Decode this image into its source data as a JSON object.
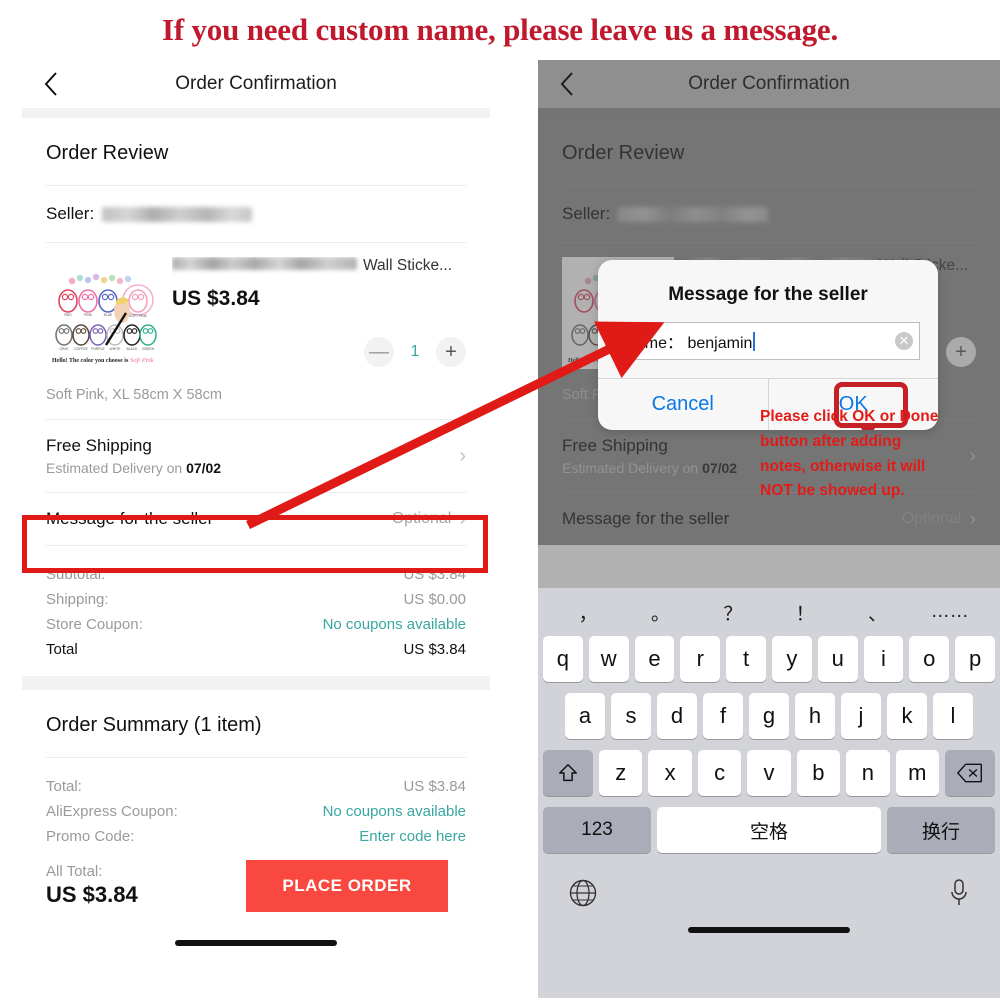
{
  "banner": {
    "text": "If you need custom name, please leave us a message."
  },
  "nav": {
    "title": "Order Confirmation",
    "back_icon": "chevron-left-icon"
  },
  "order_review": {
    "section_title": "Order Review",
    "seller_label": "Seller:",
    "product": {
      "title_suffix": "Wall Sticke...",
      "price": "US $3.84",
      "quantity": "1",
      "minus_label": "—",
      "plus_label": "+",
      "variant": "Soft Pink, XL 58cm X 58cm"
    },
    "shipping": {
      "title": "Free Shipping",
      "sub_prefix": "Estimated Delivery on ",
      "sub_date": "07/02"
    },
    "message_row": {
      "label": "Message for the seller",
      "value": "Optional"
    },
    "prices": [
      {
        "key": "Subtotal:",
        "value": "US $3.84",
        "link": false
      },
      {
        "key": "Shipping:",
        "value": "US $0.00",
        "link": false
      },
      {
        "key": "Store Coupon:",
        "value": "No coupons available",
        "link": true
      },
      {
        "key": "Total",
        "value": "US $3.84",
        "link": false,
        "emphasis": true
      }
    ]
  },
  "order_summary": {
    "section_title": "Order Summary (1 item)",
    "lines": [
      {
        "key": "Total:",
        "value": "US $3.84",
        "link": false
      },
      {
        "key": "AliExpress Coupon:",
        "value": "No coupons available",
        "link": true
      },
      {
        "key": "Promo Code:",
        "value": "Enter code here",
        "link": true
      }
    ],
    "all_total_label": "All Total:",
    "all_total_value": "US $3.84",
    "place_order_label": "PLACE ORDER"
  },
  "dialog": {
    "title": "Message for the seller",
    "input_value": "name： benjamin",
    "clear_icon": "clear-circle-icon",
    "cancel_label": "Cancel",
    "ok_label": "OK"
  },
  "annotations": {
    "note_lines": [
      "Please click OK or Done",
      "button after adding",
      "notes, otherwise it will",
      "NOT be showed up."
    ],
    "highlight_color": "#e01b17",
    "callout_color": "#c42026",
    "arrow_color": "#e01b17",
    "banner_color": "#c0182c"
  },
  "keyboard": {
    "punctuation": [
      "，",
      "。",
      "？",
      "！",
      "、",
      "……"
    ],
    "row1": [
      "q",
      "w",
      "e",
      "r",
      "t",
      "y",
      "u",
      "i",
      "o",
      "p"
    ],
    "row2": [
      "a",
      "s",
      "d",
      "f",
      "g",
      "h",
      "j",
      "k",
      "l"
    ],
    "row3": [
      "z",
      "x",
      "c",
      "v",
      "b",
      "n",
      "m"
    ],
    "shift_icon": "shift-up-arrow-icon",
    "backspace_icon": "backspace-icon",
    "numbers_label": "123",
    "space_label": "空格",
    "enter_label": "换行",
    "globe_icon": "globe-icon",
    "mic_icon": "microphone-icon"
  }
}
